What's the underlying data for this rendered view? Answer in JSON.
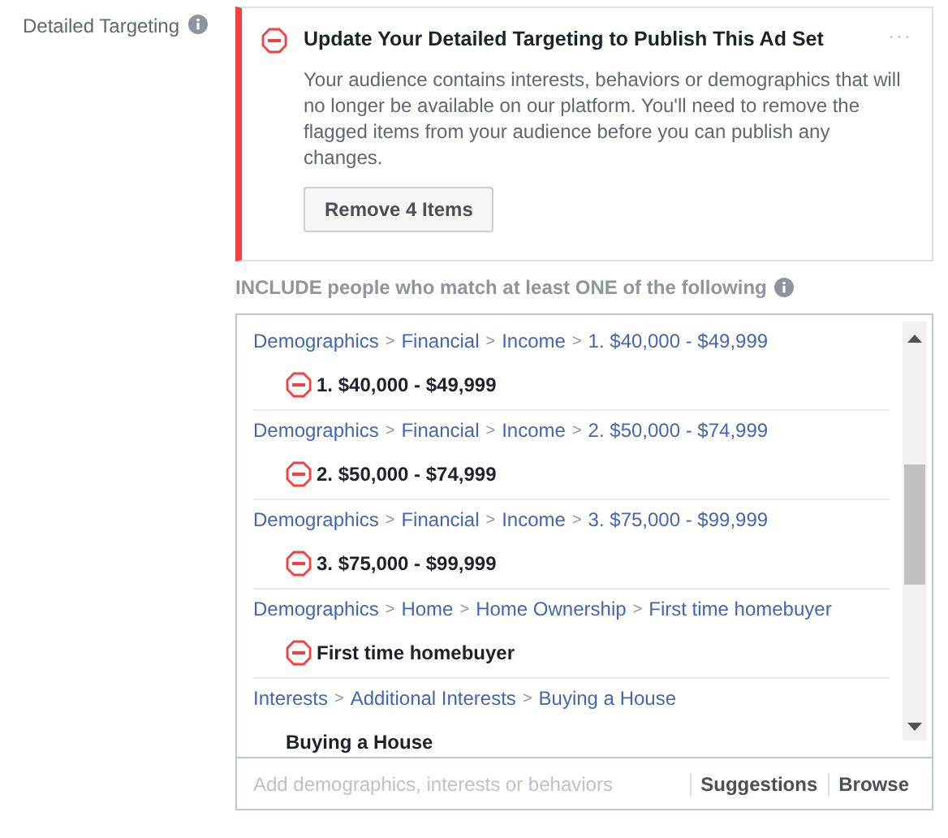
{
  "field_label": "Detailed Targeting",
  "warning": {
    "title": "Update Your Detailed Targeting to Publish This Ad Set",
    "more": "···",
    "body": "Your audience contains interests, behaviors or demographics that will no longer be available on our platform. You'll need to remove the flagged items from your audience before you can publish any changes.",
    "button": "Remove 4 Items"
  },
  "include_label": "INCLUDE people who match at least ONE of the following",
  "separator": ">",
  "items": [
    {
      "path": [
        "Demographics",
        "Financial",
        "Income",
        "1. $40,000 - $49,999"
      ],
      "name": "1. $40,000 - $49,999",
      "flagged": true
    },
    {
      "path": [
        "Demographics",
        "Financial",
        "Income",
        "2. $50,000 - $74,999"
      ],
      "name": "2. $50,000 - $74,999",
      "flagged": true
    },
    {
      "path": [
        "Demographics",
        "Financial",
        "Income",
        "3. $75,000 - $99,999"
      ],
      "name": "3. $75,000 - $99,999",
      "flagged": true
    },
    {
      "path": [
        "Demographics",
        "Home",
        "Home Ownership",
        "First time homebuyer"
      ],
      "name": "First time homebuyer",
      "flagged": true
    },
    {
      "path": [
        "Interests",
        "Additional Interests",
        "Buying a House"
      ],
      "name": "Buying a House",
      "flagged": false
    }
  ],
  "search": {
    "placeholder": "Add demographics, interests or behaviors"
  },
  "links": [
    "Suggestions",
    "Browse"
  ]
}
